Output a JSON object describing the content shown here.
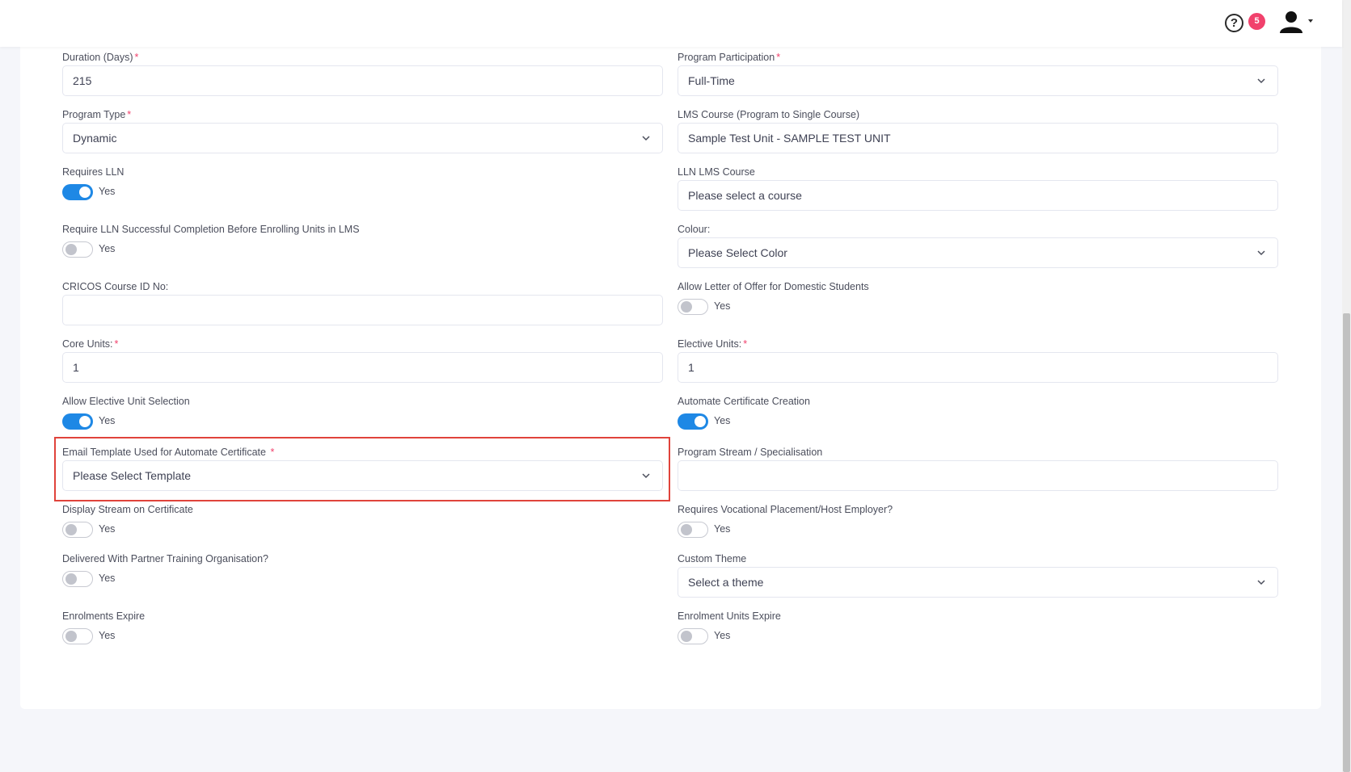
{
  "header": {
    "help_symbol": "?",
    "notification_count": "5",
    "icons": [
      "help-circle-icon",
      "user-avatar-icon",
      "caret-down-icon"
    ]
  },
  "colors": {
    "accent": "#1e88e5",
    "required": "#f1416c",
    "highlight": "#e0433b",
    "badge": "#f1416c"
  },
  "form": {
    "yes_label": "Yes",
    "duration": {
      "label": "Duration (Days)",
      "value": "215"
    },
    "program_participation": {
      "label": "Program Participation",
      "value": "Full-Time"
    },
    "program_type": {
      "label": "Program Type",
      "value": "Dynamic"
    },
    "lms_course": {
      "label": "LMS Course (Program to Single Course)",
      "value": "Sample Test Unit - SAMPLE TEST UNIT"
    },
    "requires_lln": {
      "label": "Requires LLN",
      "on": true
    },
    "lln_lms_course": {
      "label": "LLN LMS Course",
      "placeholder": "Please select a course"
    },
    "require_lln_completion": {
      "label": "Require LLN Successful Completion Before Enrolling Units in LMS",
      "on": false
    },
    "colour": {
      "label": "Colour:",
      "value": "Please Select Color"
    },
    "cricos_id": {
      "label": "CRICOS Course ID No:",
      "value": ""
    },
    "allow_letter_of_offer": {
      "label": "Allow Letter of Offer for Domestic Students",
      "on": false
    },
    "core_units": {
      "label": "Core Units:",
      "value": "1"
    },
    "elective_units": {
      "label": "Elective Units:",
      "value": "1"
    },
    "allow_elective_selection": {
      "label": "Allow Elective Unit Selection",
      "on": true
    },
    "automate_certificate": {
      "label": "Automate Certificate Creation",
      "on": true
    },
    "email_template": {
      "label": "Email Template Used for Automate Certificate",
      "value": "Please Select Template"
    },
    "program_stream": {
      "label": "Program Stream / Specialisation",
      "value": ""
    },
    "display_stream": {
      "label": "Display Stream on Certificate",
      "on": false
    },
    "vocational_placement": {
      "label": "Requires Vocational Placement/Host Employer?",
      "on": false
    },
    "partner_training": {
      "label": "Delivered With Partner Training Organisation?",
      "on": false
    },
    "custom_theme": {
      "label": "Custom Theme",
      "value": "Select a theme"
    },
    "enrolments_expire": {
      "label": "Enrolments Expire",
      "on": false
    },
    "enrolment_units_expire": {
      "label": "Enrolment Units Expire",
      "on": false
    }
  }
}
